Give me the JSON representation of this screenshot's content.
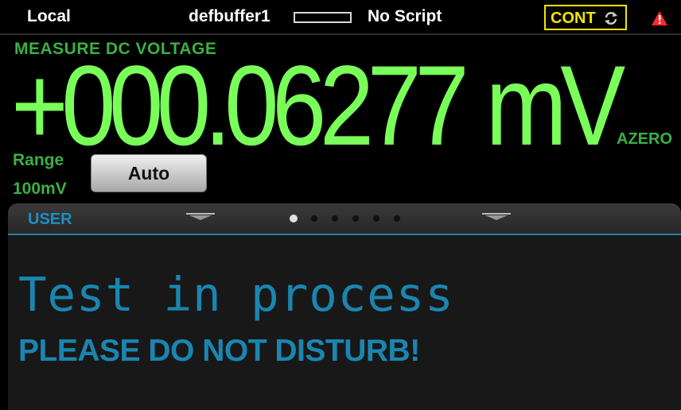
{
  "status_bar": {
    "mode": "Local",
    "buffer_name": "defbuffer1",
    "script": "No Script",
    "trigger_mode": "CONT",
    "refresh_icon": "refresh-icon",
    "warning_icon": "warning-icon",
    "colors": {
      "trigger": "#f2e600",
      "warning": "#ff2a2a"
    }
  },
  "measurement": {
    "function_title": "MEASURE DC VOLTAGE",
    "reading": "+000.06277",
    "unit": "mV",
    "azero": "AZERO",
    "range_label": "Range",
    "range_value": "100mV",
    "range_button": "Auto",
    "colors": {
      "reading": "#7aff5a",
      "labels": "#3ab044"
    }
  },
  "swipe_panel": {
    "tab_label": "USER",
    "pages": 6,
    "active_page": 1,
    "line1": "Test in process",
    "line2": "PLEASE DO NOT DISTURB!",
    "colors": {
      "text": "#1a86b0"
    }
  }
}
